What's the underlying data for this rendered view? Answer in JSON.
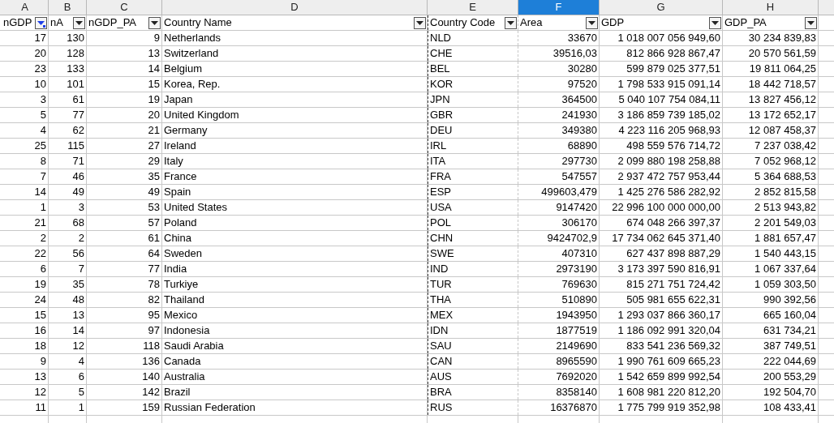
{
  "column_headers": [
    {
      "letter": "A",
      "selected": false
    },
    {
      "letter": "B",
      "selected": false
    },
    {
      "letter": "C",
      "selected": false
    },
    {
      "letter": "D",
      "selected": false
    },
    {
      "letter": "E",
      "selected": false
    },
    {
      "letter": "F",
      "selected": true
    },
    {
      "letter": "G",
      "selected": false
    },
    {
      "letter": "H",
      "selected": false
    }
  ],
  "table": {
    "columns": [
      {
        "label": "nGDP",
        "numeric": true,
        "filter_active": true
      },
      {
        "label": "nA",
        "numeric": true,
        "filter_active": false
      },
      {
        "label": "nGDP_PA",
        "numeric": true,
        "filter_active": false
      },
      {
        "label": "Country Name",
        "numeric": false,
        "filter_active": false
      },
      {
        "label": "Country Code",
        "numeric": false,
        "filter_active": false
      },
      {
        "label": "Area",
        "numeric": true,
        "filter_active": false
      },
      {
        "label": "GDP",
        "numeric": true,
        "filter_active": false
      },
      {
        "label": "GDP_PA",
        "numeric": true,
        "filter_active": false
      }
    ],
    "rows": [
      [
        "17",
        "130",
        "9",
        "Netherlands",
        "NLD",
        "33670",
        "1 018 007 056 949,60",
        "30 234 839,83"
      ],
      [
        "20",
        "128",
        "13",
        "Switzerland",
        "CHE",
        "39516,03",
        "812 866 928 867,47",
        "20 570 561,59"
      ],
      [
        "23",
        "133",
        "14",
        "Belgium",
        "BEL",
        "30280",
        "599 879 025 377,51",
        "19 811 064,25"
      ],
      [
        "10",
        "101",
        "15",
        "Korea, Rep.",
        "KOR",
        "97520",
        "1 798 533 915 091,14",
        "18 442 718,57"
      ],
      [
        "3",
        "61",
        "19",
        "Japan",
        "JPN",
        "364500",
        "5 040 107 754 084,11",
        "13 827 456,12"
      ],
      [
        "5",
        "77",
        "20",
        "United Kingdom",
        "GBR",
        "241930",
        "3 186 859 739 185,02",
        "13 172 652,17"
      ],
      [
        "4",
        "62",
        "21",
        "Germany",
        "DEU",
        "349380",
        "4 223 116 205 968,93",
        "12 087 458,37"
      ],
      [
        "25",
        "115",
        "27",
        "Ireland",
        "IRL",
        "68890",
        "498 559 576 714,72",
        "7 237 038,42"
      ],
      [
        "8",
        "71",
        "29",
        "Italy",
        "ITA",
        "297730",
        "2 099 880 198 258,88",
        "7 052 968,12"
      ],
      [
        "7",
        "46",
        "35",
        "France",
        "FRA",
        "547557",
        "2 937 472 757 953,44",
        "5 364 688,53"
      ],
      [
        "14",
        "49",
        "49",
        "Spain",
        "ESP",
        "499603,479",
        "1 425 276 586 282,92",
        "2 852 815,58"
      ],
      [
        "1",
        "3",
        "53",
        "United States",
        "USA",
        "9147420",
        "22 996 100 000 000,00",
        "2 513 943,82"
      ],
      [
        "21",
        "68",
        "57",
        "Poland",
        "POL",
        "306170",
        "674 048 266 397,37",
        "2 201 549,03"
      ],
      [
        "2",
        "2",
        "61",
        "China",
        "CHN",
        "9424702,9",
        "17 734 062 645 371,40",
        "1 881 657,47"
      ],
      [
        "22",
        "56",
        "64",
        "Sweden",
        "SWE",
        "407310",
        "627 437 898 887,29",
        "1 540 443,15"
      ],
      [
        "6",
        "7",
        "77",
        "India",
        "IND",
        "2973190",
        "3 173 397 590 816,91",
        "1 067 337,64"
      ],
      [
        "19",
        "35",
        "78",
        "Turkiye",
        "TUR",
        "769630",
        "815 271 751 724,42",
        "1 059 303,50"
      ],
      [
        "24",
        "48",
        "82",
        "Thailand",
        "THA",
        "510890",
        "505 981 655 622,31",
        "990 392,56"
      ],
      [
        "15",
        "13",
        "95",
        "Mexico",
        "MEX",
        "1943950",
        "1 293 037 866 360,17",
        "665 160,04"
      ],
      [
        "16",
        "14",
        "97",
        "Indonesia",
        "IDN",
        "1877519",
        "1 186 092 991 320,04",
        "631 734,21"
      ],
      [
        "18",
        "12",
        "118",
        "Saudi Arabia",
        "SAU",
        "2149690",
        "833 541 236 569,32",
        "387 749,51"
      ],
      [
        "9",
        "4",
        "136",
        "Canada",
        "CAN",
        "8965590",
        "1 990 761 609 665,23",
        "222 044,69"
      ],
      [
        "13",
        "6",
        "140",
        "Australia",
        "AUS",
        "7692020",
        "1 542 659 899 992,54",
        "200 553,29"
      ],
      [
        "12",
        "5",
        "142",
        "Brazil",
        "BRA",
        "8358140",
        "1 608 981 220 812,20",
        "192 504,70"
      ],
      [
        "11",
        "1",
        "159",
        "Russian Federation",
        "RUS",
        "16376870",
        "1 775 799 919 352,98",
        "108 433,41"
      ]
    ]
  }
}
